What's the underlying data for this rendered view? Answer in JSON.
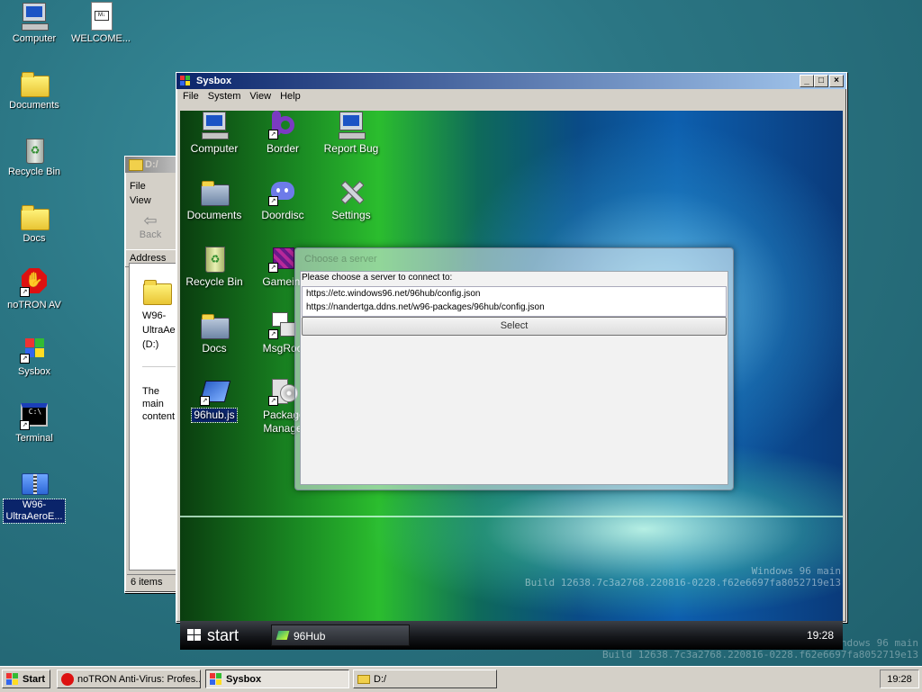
{
  "desktop": {
    "icons": [
      {
        "label": "Computer"
      },
      {
        "label": "WELCOME..."
      },
      {
        "label": "Documents"
      },
      {
        "label": "Recycle Bin"
      },
      {
        "label": "Docs"
      },
      {
        "label": "noTRON AV"
      },
      {
        "label": "Sysbox"
      },
      {
        "label": "Terminal"
      },
      {
        "label": "W96-UltraAeroE..."
      }
    ],
    "watermark_line1": "Windows 96 main",
    "watermark_line2": "Build 12638.7c3a2768.220816-0228.f62e6697fa8052719e13"
  },
  "explorer": {
    "title": "D:/",
    "menu": [
      "File",
      "View"
    ],
    "back_label": "Back",
    "address_label": "Address",
    "drive_label": "W96-UltraAe (D:)",
    "description": "The main content",
    "status": "6 items"
  },
  "sysbox": {
    "title": "Sysbox",
    "menu": [
      "File",
      "System",
      "View",
      "Help"
    ],
    "icons": [
      {
        "label": "Computer"
      },
      {
        "label": "Border"
      },
      {
        "label": "Report Bug"
      },
      {
        "label": "Documents"
      },
      {
        "label": "Doordisc"
      },
      {
        "label": "Settings"
      },
      {
        "label": "Recycle Bin"
      },
      {
        "label": "Gameinf"
      },
      {
        "label": "Docs"
      },
      {
        "label": "MsgRoo"
      },
      {
        "label": "96hub.js"
      },
      {
        "label": "Package Manage"
      }
    ],
    "inner_watermark_line1": "Windows 96 main",
    "inner_watermark_line2": "Build 12638.7c3a2768.220816-0228.f62e6697fa8052719e13",
    "inner_taskbar": {
      "start_label": "start",
      "task_label": "96Hub",
      "clock": "19:28"
    },
    "dialog": {
      "title": "Choose a server",
      "prompt": "Please choose a server to connect to:",
      "servers": [
        "https://etc.windows96.net/96hub/config.json",
        "https://nandertga.ddns.net/w96-packages/96hub/config.json"
      ],
      "select_label": "Select"
    }
  },
  "taskbar": {
    "start_label": "Start",
    "tasks": [
      {
        "label": "noTRON Anti-Virus: Profes..."
      },
      {
        "label": "Sysbox"
      },
      {
        "label": "D:/"
      }
    ],
    "clock": "19:28"
  }
}
